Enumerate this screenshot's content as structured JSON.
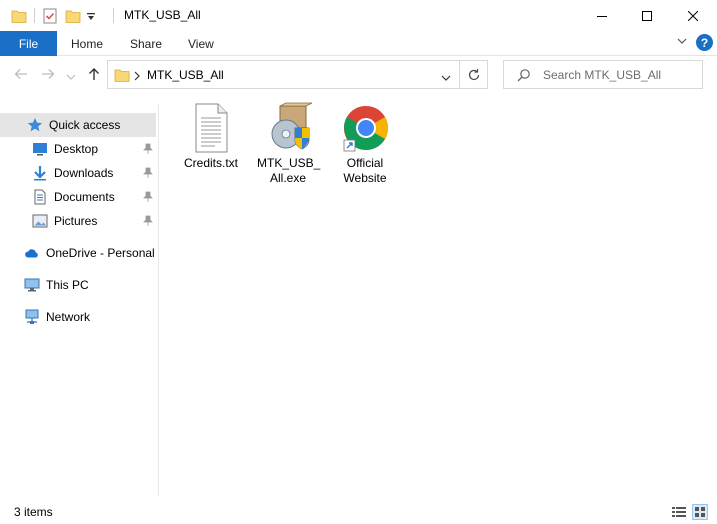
{
  "window": {
    "title": "MTK_USB_All",
    "controls": {
      "minimize": "minimize-icon",
      "maximize": "maximize-icon",
      "close": "close-icon"
    }
  },
  "ribbon": {
    "tabs": [
      "File",
      "Home",
      "Share",
      "View"
    ],
    "help": "?"
  },
  "address": {
    "path": "MTK_USB_All",
    "search_placeholder": "Search MTK_USB_All"
  },
  "sidebar": {
    "quick_access": "Quick access",
    "items": [
      {
        "label": "Desktop",
        "icon": "desktop-icon",
        "pinned": true
      },
      {
        "label": "Downloads",
        "icon": "download-icon",
        "pinned": true
      },
      {
        "label": "Documents",
        "icon": "documents-icon",
        "pinned": true
      },
      {
        "label": "Pictures",
        "icon": "pictures-icon",
        "pinned": true
      }
    ],
    "onedrive": "OneDrive - Personal",
    "thispc": "This PC",
    "network": "Network"
  },
  "files": [
    {
      "name": "Credits.txt",
      "icon": "text-file-icon"
    },
    {
      "name_line1": "MTK_USB_",
      "name_line2": "All.exe",
      "icon": "installer-icon"
    },
    {
      "name_line1": "Official",
      "name_line2": "Website",
      "icon": "chrome-shortcut-icon"
    }
  ],
  "status": {
    "count": "3 items"
  },
  "colors": {
    "accent": "#1a6fc6",
    "selected": "#e5e5e5",
    "folder": "#f8d775"
  }
}
